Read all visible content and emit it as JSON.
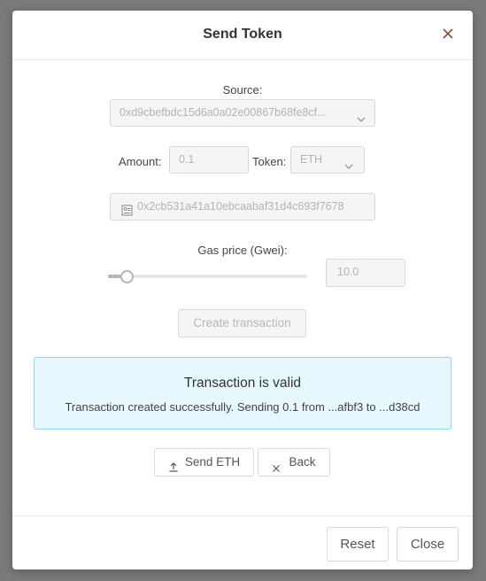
{
  "dialog": {
    "title": "Send Token"
  },
  "form": {
    "source_label": "Source:",
    "source_value": "0xd9cbefbdc15d6a0a02e00867b68fe8cf...",
    "amount_label": "Amount:",
    "amount_value": "0.1",
    "token_label": "Token:",
    "token_value": "ETH",
    "recipient_value": "0x2cb531a41a10ebcaabaf31d4c693f7678",
    "gas_label": "Gas price (Gwei):",
    "gas_value": "10.0",
    "gas_slider_level": 0.06,
    "create_button": "Create transaction"
  },
  "alert": {
    "title": "Transaction is valid",
    "message": "Transaction created successfully. Sending 0.1 from ...afbf3 to ...d38cd"
  },
  "actions": {
    "send_label": "Send ETH",
    "back_label": "Back"
  },
  "footer": {
    "reset_label": "Reset",
    "close_label": "Close"
  },
  "colors": {
    "alert_bg": "#e6f7fd",
    "alert_border": "#92d5ec",
    "slider_track": "#e5e5e5",
    "slider_fill": "#b5b5b5"
  }
}
